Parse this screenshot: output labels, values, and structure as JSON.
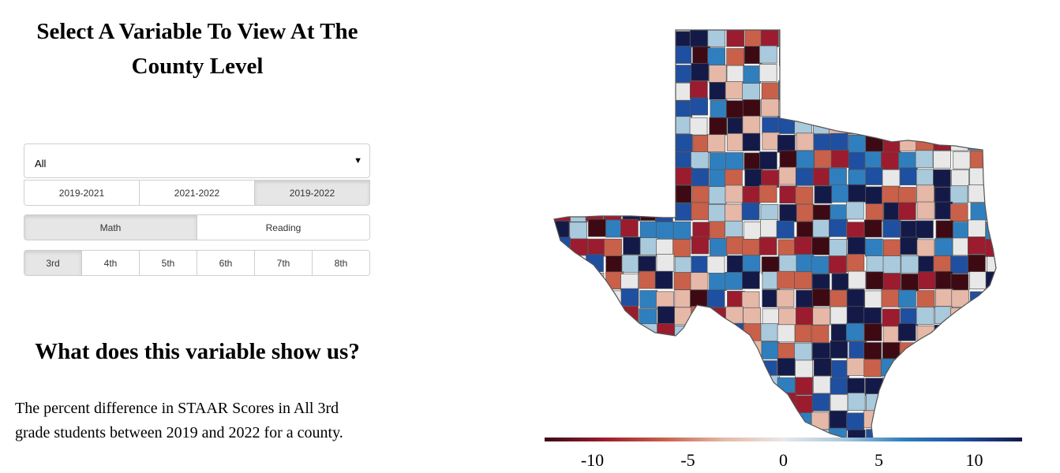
{
  "panel": {
    "title": "Select A Variable To View At The County Level",
    "group_select": {
      "value": "All"
    },
    "years": [
      {
        "label": "2019-2021",
        "active": false
      },
      {
        "label": "2021-2022",
        "active": false
      },
      {
        "label": "2019-2022",
        "active": true
      }
    ],
    "subjects": [
      {
        "label": "Math",
        "active": true
      },
      {
        "label": "Reading",
        "active": false
      }
    ],
    "grades": [
      {
        "label": "3rd",
        "active": true
      },
      {
        "label": "4th",
        "active": false
      },
      {
        "label": "5th",
        "active": false
      },
      {
        "label": "6th",
        "active": false
      },
      {
        "label": "7th",
        "active": false
      },
      {
        "label": "8th",
        "active": false
      }
    ]
  },
  "explanation": {
    "title": "What does this variable show us?",
    "text": "The percent difference in STAAR Scores in All 3rd grade students between 2019 and 2022 for a county."
  },
  "legend": {
    "ticks": [
      "-10",
      "-5",
      "0",
      "5",
      "10"
    ],
    "tick_values": [
      -10,
      -5,
      0,
      5,
      10
    ],
    "domain": [
      -12.5,
      12.5
    ],
    "colors": [
      "#3d0a14",
      "#9b1c2e",
      "#c9604a",
      "#e5b8a8",
      "#e8e8e8",
      "#a9c9dc",
      "#2f7fbf",
      "#1f4fa0",
      "#141a48"
    ]
  }
}
